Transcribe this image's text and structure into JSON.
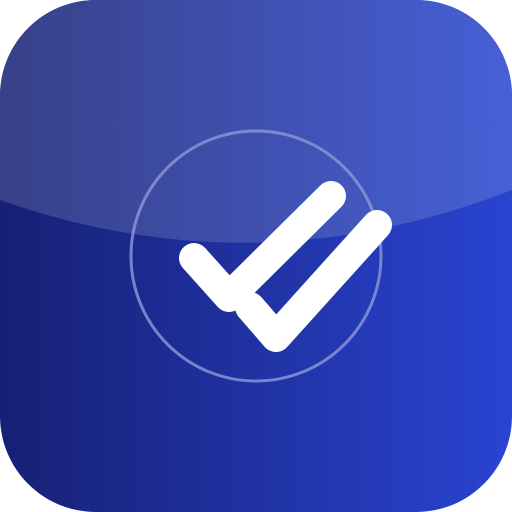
{
  "icon": {
    "name": "double-checkmark-app-icon",
    "glyph": "double-check-icon",
    "colors": {
      "bg_dark": "#162074",
      "bg_light": "#2A44D2",
      "gloss_dark": "#384188",
      "gloss_light": "#4660D6",
      "ring": "#8A93D6",
      "check": "#FFFFFF"
    }
  }
}
